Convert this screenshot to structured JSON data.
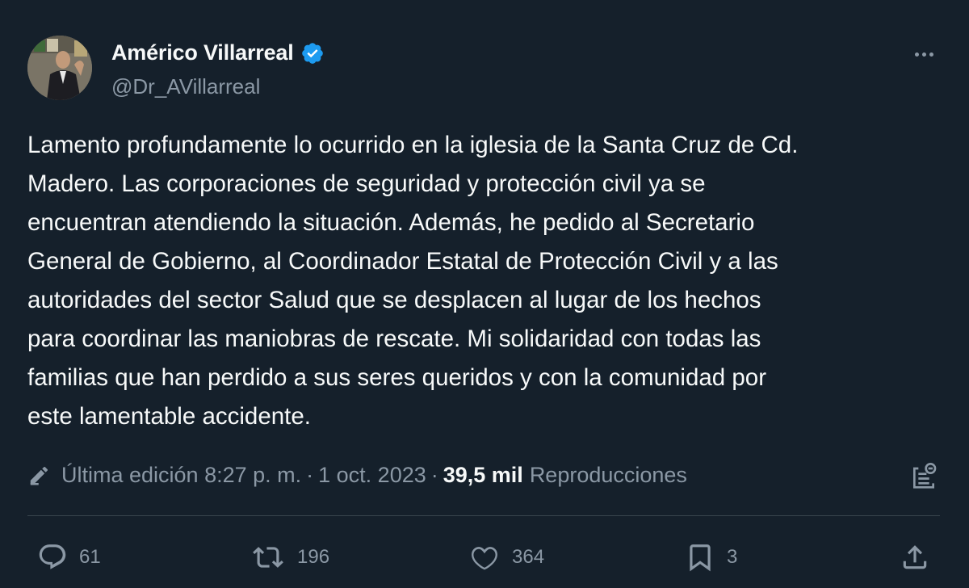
{
  "author": {
    "name": "Américo Villarreal",
    "handle": "@Dr_AVillarreal",
    "verified": true,
    "verified_color": "#1d9bf0"
  },
  "tweet": {
    "text": "Lamento profundamente lo ocurrido en la iglesia de la Santa Cruz de Cd.\nMadero. Las corporaciones de seguridad y protección civil ya se\nencuentran atendiendo la situación. Además, he pedido al Secretario\nGeneral de Gobierno, al Coordinador Estatal de Protección Civil y a las\nautoridades del sector Salud que se desplacen al lugar de los hechos\npara coordinar las maniobras de rescate. Mi solidaridad con todas las\nfamilias que han perdido a sus seres queridos y con la comunidad por\neste lamentable accidente."
  },
  "meta": {
    "edited_label": "Última edición 8:27 p. m.",
    "separator": "·",
    "date": "1 oct. 2023",
    "views_count": "39,5 mil",
    "views_label": "Reproducciones"
  },
  "actions": {
    "replies": "61",
    "reposts": "196",
    "likes": "364",
    "bookmarks": "3"
  },
  "icons": [
    "more-icon",
    "verified-icon",
    "edit-icon",
    "analytics-icon",
    "reply-icon",
    "repost-icon",
    "like-icon",
    "bookmark-icon",
    "share-icon"
  ],
  "colors": {
    "background": "#15202b",
    "text": "#f7f9f9",
    "secondary": "#8b98a5",
    "divider": "#38444d"
  }
}
